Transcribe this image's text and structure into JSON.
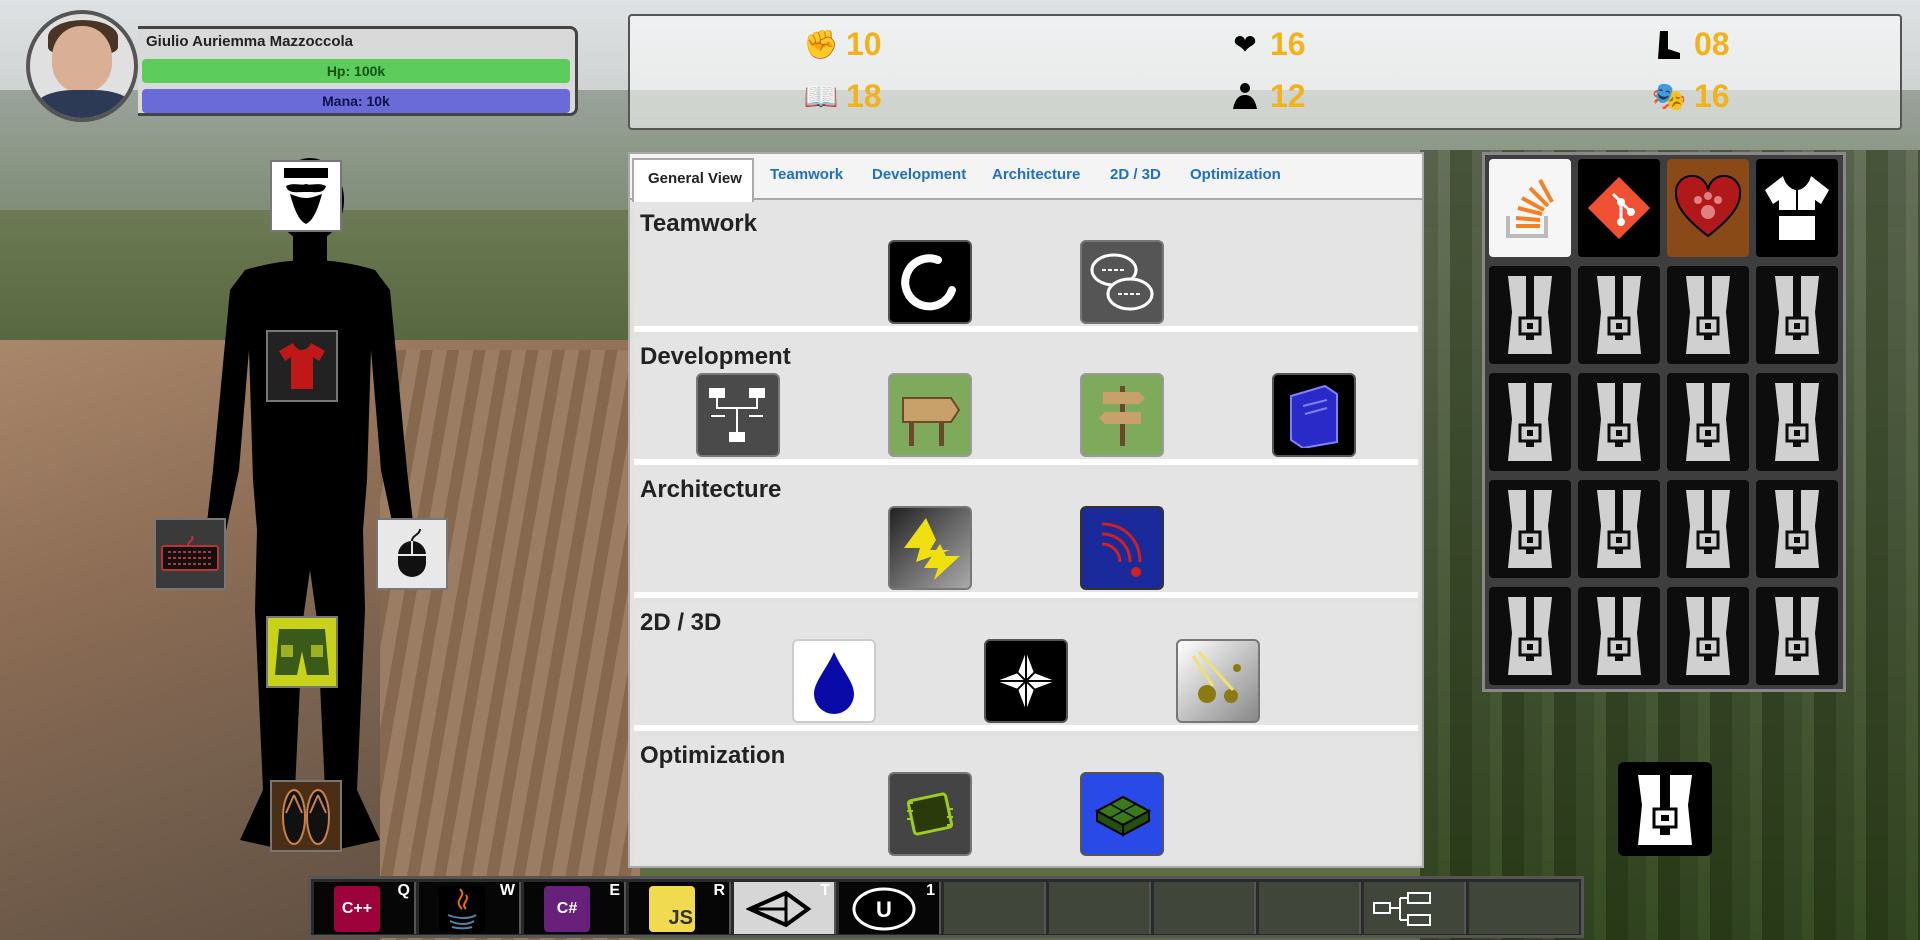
{
  "player": {
    "name": "Giulio Auriemma Mazzoccola",
    "hp": "Hp: 100k",
    "mana": "Mana: 10k"
  },
  "stats": [
    {
      "icon": "fist-icon",
      "value": "10"
    },
    {
      "icon": "heart-pulse-icon",
      "value": "16"
    },
    {
      "icon": "boot-icon",
      "value": "08"
    },
    {
      "icon": "reading-icon",
      "value": "18"
    },
    {
      "icon": "meditation-icon",
      "value": "12"
    },
    {
      "icon": "theater-masks-icon",
      "value": "16"
    }
  ],
  "tabs": [
    "General View",
    "Teamwork",
    "Development",
    "Architecture",
    "2D / 3D",
    "Optimization"
  ],
  "sections": [
    {
      "title": "Teamwork",
      "skills": [
        "enso-circle-icon",
        "speech-bubbles-icon"
      ]
    },
    {
      "title": "Development",
      "skills": [
        "hierarchy-icon",
        "wooden-sign-icon",
        "signpost-icon",
        "book-icon"
      ]
    },
    {
      "title": "Architecture",
      "skills": [
        "lightning-icon",
        "radio-waves-icon"
      ]
    },
    {
      "title": "2D / 3D",
      "skills": [
        "water-drop-icon",
        "star-compass-icon",
        "spheres-icon"
      ]
    },
    {
      "title": "Optimization",
      "skills": [
        "circuit-chip-icon",
        "grid-cube-icon"
      ]
    }
  ],
  "inventory": {
    "top_row": [
      "stackoverflow-icon",
      "git-icon",
      "paw-heart-icon",
      "karate-gi-icon"
    ],
    "empty_slots": 16
  },
  "hotbar": [
    {
      "key": "Q",
      "icon": "cpp-icon",
      "label": "C++"
    },
    {
      "key": "W",
      "icon": "java-icon",
      "label": ""
    },
    {
      "key": "E",
      "icon": "csharp-icon",
      "label": "C#"
    },
    {
      "key": "R",
      "icon": "javascript-icon",
      "label": "JS"
    },
    {
      "key": "T",
      "icon": "unity-icon",
      "label": ""
    },
    {
      "key": "1",
      "icon": "unreal-icon",
      "label": "U"
    }
  ],
  "colors": {
    "stat_value": "#f2b21a",
    "hp": "#5ccc5c",
    "mana": "#6a6ad8",
    "tab_link": "#1e6fc9"
  }
}
